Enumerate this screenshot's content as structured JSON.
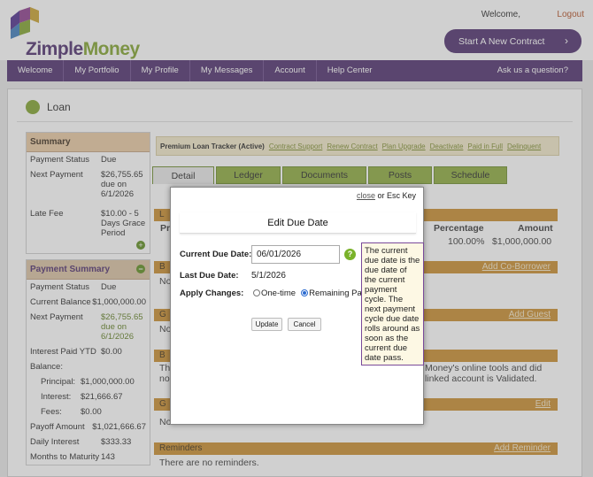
{
  "header": {
    "logo_text_a": "Zimple",
    "logo_text_b": "Money",
    "welcome": "Welcome,",
    "logout": "Logout",
    "start_contract": "Start A New Contract"
  },
  "nav": {
    "items": [
      "Welcome",
      "My Portfolio",
      "My Profile",
      "My Messages",
      "Account",
      "Help Center"
    ],
    "ask": "Ask us a question?"
  },
  "page": {
    "title": "Loan"
  },
  "summary": {
    "heading": "Summary",
    "rows": [
      {
        "k": "Payment Status",
        "v": "Due"
      },
      {
        "k": "Next Payment",
        "v": "$26,755.65 due on 6/1/2026"
      },
      {
        "k": "Late Fee",
        "v": "$10.00 - 5 Days Grace Period"
      }
    ]
  },
  "payment_summary": {
    "heading": "Payment Summary",
    "rows": [
      {
        "k": "Payment Status",
        "v": "Due"
      },
      {
        "k": "Current Balance",
        "v": "$1,000,000.00"
      },
      {
        "k": "Next Payment",
        "v": "$26,755.65 due on 6/1/2026"
      },
      {
        "k": "Interest Paid YTD",
        "v": "$0.00"
      },
      {
        "k": "Balance:",
        "v": ""
      },
      {
        "k": "Principal:",
        "v": "$1,000,000.00"
      },
      {
        "k": "Interest:",
        "v": "$21,666.67"
      },
      {
        "k": "Fees:",
        "v": "$0.00"
      },
      {
        "k": "Payoff Amount",
        "v": "$1,021,666.67"
      },
      {
        "k": "Daily Interest",
        "v": "$333.33"
      },
      {
        "k": "Months to Maturity",
        "v": "143"
      }
    ]
  },
  "tracker": {
    "title": "Premium Loan Tracker (Active)",
    "links": [
      "Contract Support",
      "Renew Contract",
      "Plan Upgrade",
      "Deactivate",
      "Paid in Full",
      "Delinquent"
    ]
  },
  "tabs": [
    "Detail",
    "Ledger",
    "Documents",
    "Posts",
    "Schedule"
  ],
  "main": {
    "bar1_letter": "L",
    "col_pr": "Pr",
    "col_percentage": "Percentage",
    "col_amount": "Amount",
    "percentage_value": "100.00%",
    "amount_value": "$1,000,000.00",
    "bar_b_letter": "B",
    "add_coborrower": "Add Co-Borrower",
    "no_text_1": "No",
    "bar_g_letter": "G",
    "add_guest": "Add Guest",
    "no_text_2": "No",
    "bar_b2_letter": "B",
    "th_text": "Th",
    "no_text_3": "no",
    "money_line_1": "Money's online tools and did",
    "money_line_2": "linked account is Validated.",
    "bar_g2_letter": "G",
    "edit_link": "Edit",
    "no_text_4": "No",
    "reminders_heading": "Reminders",
    "add_reminder": "Add Reminder",
    "no_reminders": "There are no reminders."
  },
  "modal": {
    "close": "close",
    "close_suffix": "or Esc Key",
    "title": "Edit Due Date",
    "current_due_label": "Current Due Date:",
    "current_due_value": "06/01/2026",
    "last_due_label": "Last Due Date:",
    "last_due_value": "5/1/2026",
    "apply_label": "Apply Changes:",
    "radio_one": "One-time",
    "radio_remaining": "Remaining Payments",
    "update": "Update",
    "cancel": "Cancel",
    "tooltip": "The current due date is the due date of the current payment cycle. The next payment cycle due date rolls around as soon as the current due date pass."
  }
}
